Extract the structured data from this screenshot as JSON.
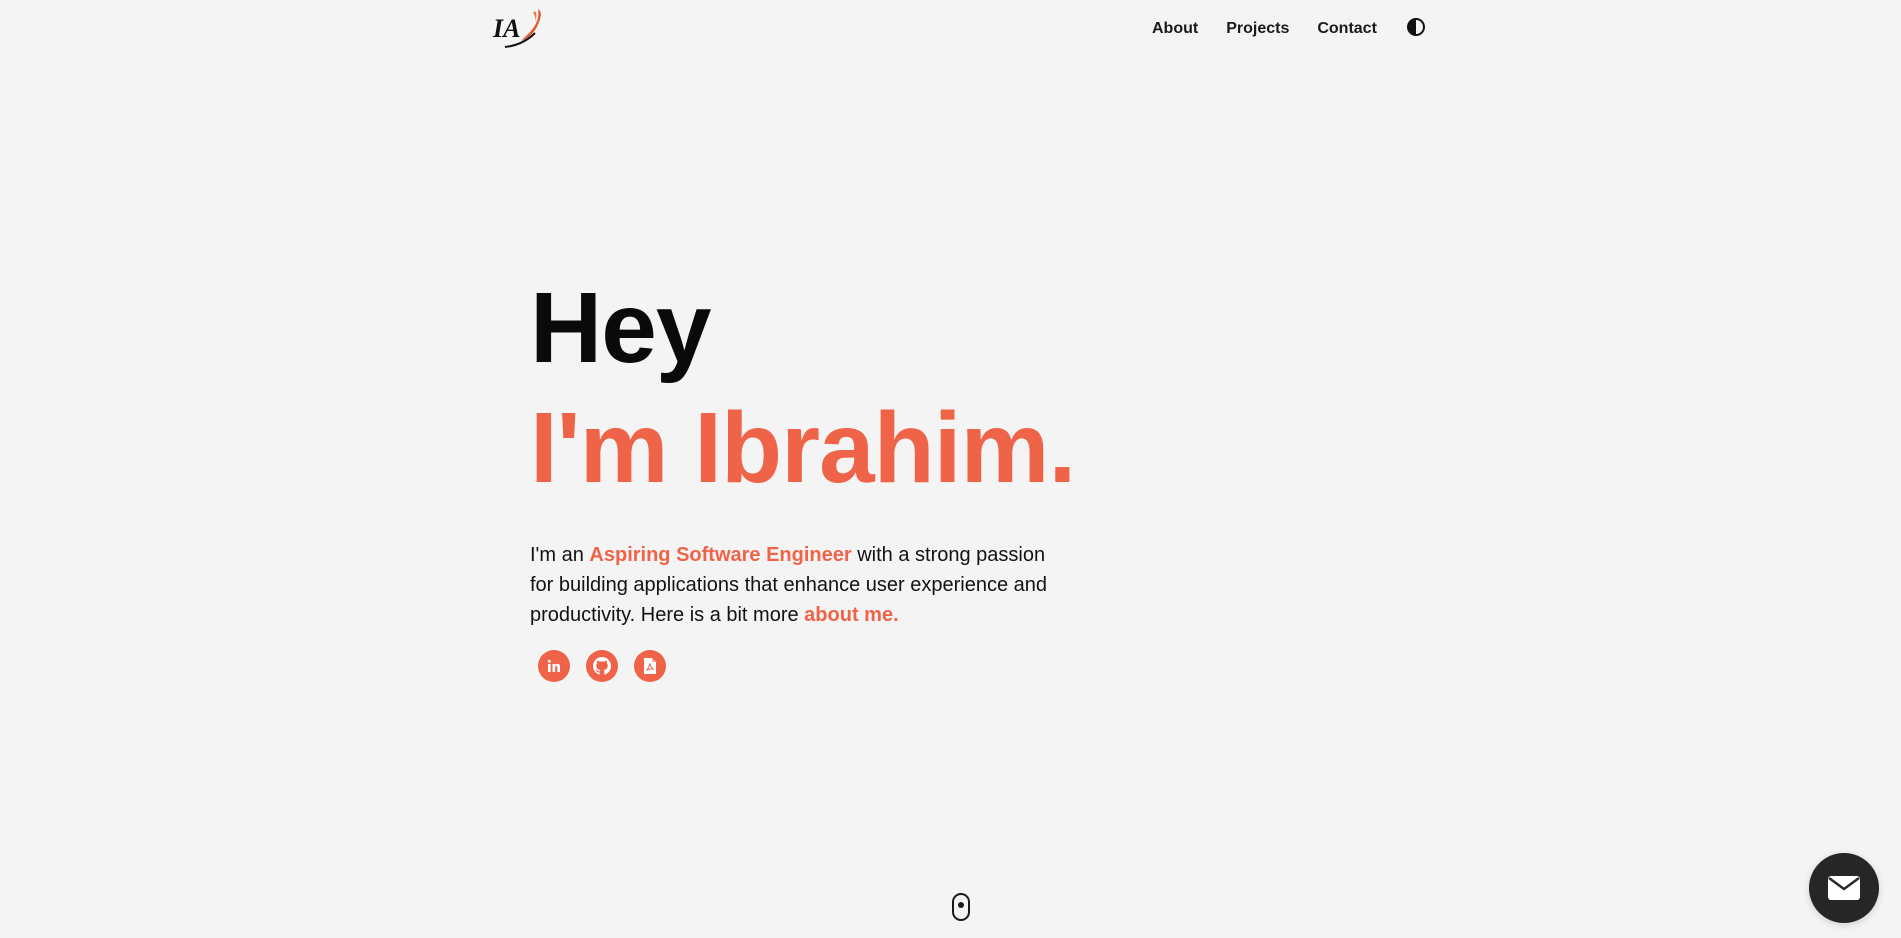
{
  "header": {
    "logo_text": "IA",
    "nav": [
      {
        "label": "About"
      },
      {
        "label": "Projects"
      },
      {
        "label": "Contact"
      }
    ],
    "theme_toggle_icon": "half-circle-contrast-icon"
  },
  "hero": {
    "greeting": "Hey",
    "name_line": "I'm Ibrahim.",
    "bio": {
      "part1": "I'm an ",
      "highlight_role": "Aspiring Software Engineer",
      "part2": " with a strong passion for building applications that enhance user experience and productivity. Here is a bit more ",
      "about_link": "about me."
    },
    "socials": [
      {
        "icon": "linkedin-icon"
      },
      {
        "icon": "github-icon"
      },
      {
        "icon": "resume-pdf-icon"
      }
    ]
  },
  "scroll_indicator_icon": "mouse-scroll-icon",
  "mail_button_icon": "envelope-icon",
  "colors": {
    "accent": "#ef6449",
    "background": "#f4f4f4",
    "text": "#0a0a0a",
    "fab": "#262626"
  }
}
